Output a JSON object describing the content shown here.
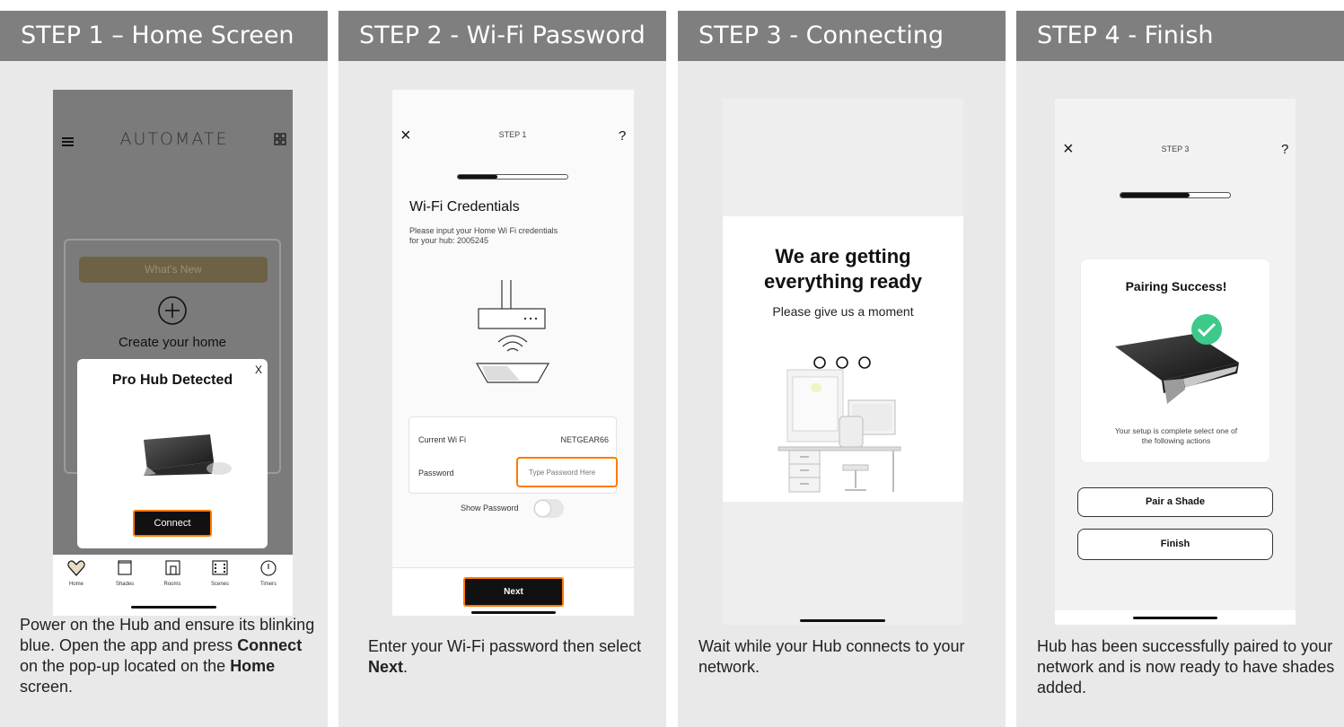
{
  "colors": {
    "header_bg": "#7f7f7f",
    "column_bg": "#e9e9ea",
    "highlight": "#ff7a00",
    "success": "#3cc98a"
  },
  "steps": [
    {
      "header": "STEP 1 – Home Screen",
      "desc_parts": [
        "Power on the Hub and ensure its blinking blue. Open the app and press ",
        "Connect",
        " on the pop-up located on the ",
        "Home",
        " screen."
      ],
      "phone": {
        "logo": "AUTOMATE",
        "menu_icon": "hamburger-icon",
        "grid_icon": "grid-icon",
        "whats_new": "What's New",
        "create_home": "Create your home",
        "popup_title": "Pro Hub Detected",
        "popup_close": "X",
        "connect": "Connect",
        "nav": [
          {
            "label": "Home",
            "icon": "heart-icon"
          },
          {
            "label": "Shades",
            "icon": "shade-icon"
          },
          {
            "label": "Rooms",
            "icon": "room-icon"
          },
          {
            "label": "Scenes",
            "icon": "scenes-icon"
          },
          {
            "label": "Timers",
            "icon": "timer-icon"
          }
        ]
      }
    },
    {
      "header": "STEP 2 - Wi-Fi Password",
      "desc_parts": [
        "Enter your Wi-Fi password then select ",
        "Next",
        "."
      ],
      "phone": {
        "close": "×",
        "step": "STEP 1",
        "help": "?",
        "title": "Wi-Fi Credentials",
        "subtitle_line1": "Please input your Home Wi Fi credentials",
        "subtitle_line2": "for your hub: 2005245",
        "wifi_label": "Current Wi Fi",
        "wifi_value": "NETGEAR66",
        "password_label": "Password",
        "password_placeholder": "Type Password Here",
        "show_password": "Show Password",
        "next": "Next"
      }
    },
    {
      "header": "STEP 3 - Connecting",
      "desc_parts": [
        "Wait while your Hub connects to your network."
      ],
      "phone": {
        "title_line1": "We are getting",
        "title_line2": "everything ready",
        "subtitle": "Please give us a moment"
      }
    },
    {
      "header": "STEP 4 - Finish",
      "desc_parts": [
        "Hub has been successfully paired to your network and is now ready to have shades added."
      ],
      "phone": {
        "close": "×",
        "step": "STEP 3",
        "help": "?",
        "card_title": "Pairing Success!",
        "card_text_line1": "Your setup is complete select one of",
        "card_text_line2": "the following actions",
        "pair_shade": "Pair a Shade",
        "finish": "Finish"
      }
    }
  ]
}
